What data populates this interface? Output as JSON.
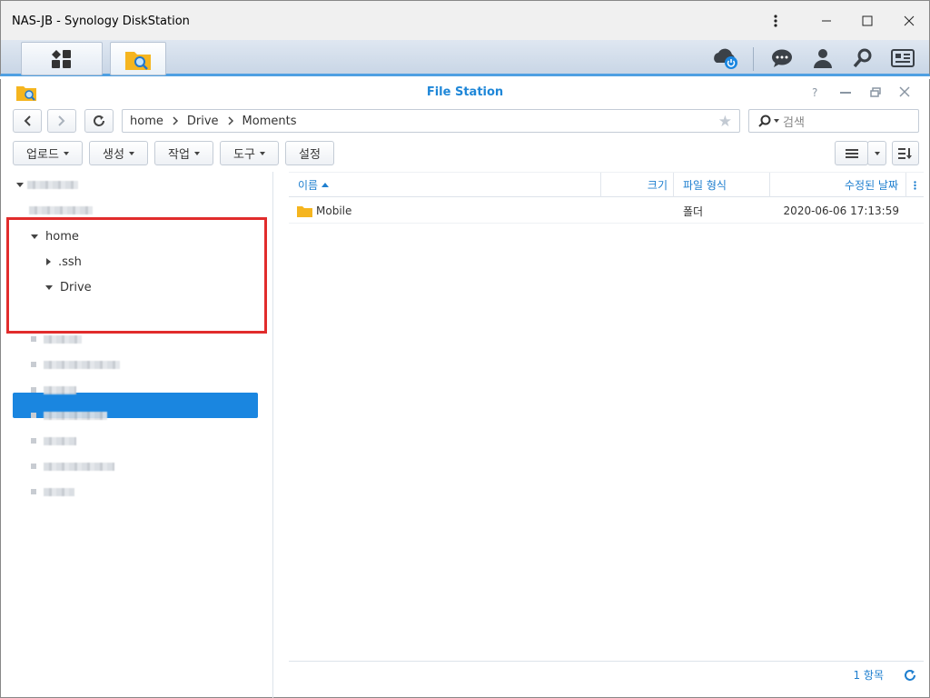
{
  "window": {
    "title": "NAS-JB - Synology DiskStation"
  },
  "app": {
    "title": "File Station"
  },
  "path": {
    "segments": [
      "home",
      "Drive",
      "Moments"
    ]
  },
  "search": {
    "placeholder": "검색"
  },
  "toolbar": {
    "upload": "업로드",
    "create": "생성",
    "action": "작업",
    "tools": "도구",
    "settings": "설정"
  },
  "tree": {
    "home": "home",
    "ssh": ".ssh",
    "drive": "Drive",
    "moments": "Moments"
  },
  "columns": {
    "name": "이름",
    "size": "크기",
    "type": "파일 형식",
    "modified": "수정된 날짜"
  },
  "files": [
    {
      "name": "Mobile",
      "size": "",
      "type": "폴더",
      "modified": "2020-06-06 17:13:59"
    }
  ],
  "status": {
    "count": "1 항목"
  },
  "colors": {
    "accent": "#1a86e0",
    "highlight": "#e12c2c",
    "folder": "#f5b51f"
  }
}
